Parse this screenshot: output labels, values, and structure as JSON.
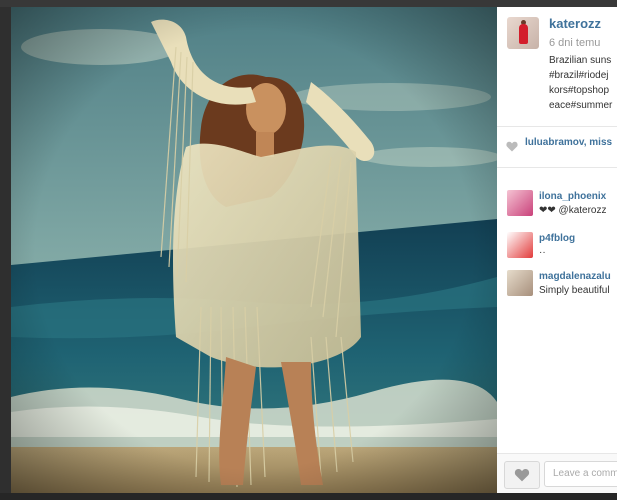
{
  "post": {
    "username": "katerozz",
    "time": "6 dni temu",
    "caption_lines": [
      "Brazilian suns",
      "#brazil#riodej",
      "kors#topshop",
      "eace#summer"
    ]
  },
  "likes": {
    "text": "luluabramov, miss"
  },
  "comments": [
    {
      "user": "ilona_phoenix",
      "text": "❤❤ @katerozz"
    },
    {
      "user": "p4fblog",
      "text": "··"
    },
    {
      "user": "magdalenazalu",
      "text": "Simply beautiful"
    }
  ],
  "footer": {
    "comment_placeholder": "Leave a comment..."
  },
  "colors": {
    "link": "#3f729b",
    "panel_bg": "#ffffff",
    "frame": "#2f2f2f"
  }
}
